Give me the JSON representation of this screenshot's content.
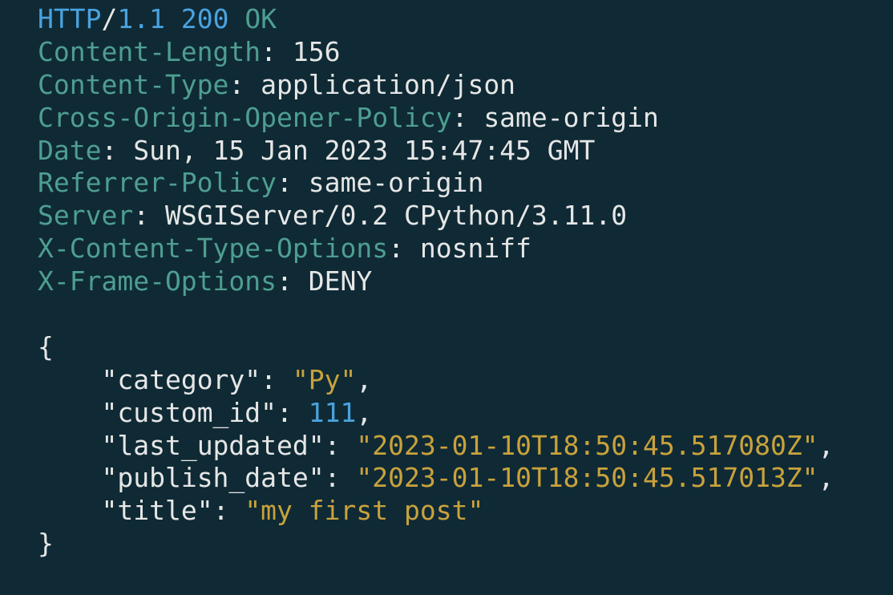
{
  "colors": {
    "background": "#0f2a35",
    "header_key": "#4e9e91",
    "protocol": "#4aa3df",
    "string": "#c9a23c",
    "number": "#4aa3df",
    "text": "#e6e6e6"
  },
  "status_line": {
    "protocol": "HTTP",
    "slash": "/",
    "version": "1.1",
    "code": "200",
    "reason": "OK"
  },
  "headers": [
    {
      "name": "Content-Length",
      "value": "156"
    },
    {
      "name": "Content-Type",
      "value": "application/json"
    },
    {
      "name": "Cross-Origin-Opener-Policy",
      "value": "same-origin"
    },
    {
      "name": "Date",
      "value": "Sun, 15 Jan 2023 15:47:45 GMT"
    },
    {
      "name": "Referrer-Policy",
      "value": "same-origin"
    },
    {
      "name": "Server",
      "value": "WSGIServer/0.2 CPython/3.11.0"
    },
    {
      "name": "X-Content-Type-Options",
      "value": "nosniff"
    },
    {
      "name": "X-Frame-Options",
      "value": "DENY"
    }
  ],
  "body": {
    "open_brace": "{",
    "close_brace": "}",
    "fields": [
      {
        "key": "\"category\"",
        "value": "\"Py\"",
        "type": "string",
        "comma": ","
      },
      {
        "key": "\"custom_id\"",
        "value": "111",
        "type": "number",
        "comma": ","
      },
      {
        "key": "\"last_updated\"",
        "value": "\"2023-01-10T18:50:45.517080Z\"",
        "type": "string",
        "comma": ","
      },
      {
        "key": "\"publish_date\"",
        "value": "\"2023-01-10T18:50:45.517013Z\"",
        "type": "string",
        "comma": ","
      },
      {
        "key": "\"title\"",
        "value": "\"my first post\"",
        "type": "string",
        "comma": ""
      }
    ]
  }
}
